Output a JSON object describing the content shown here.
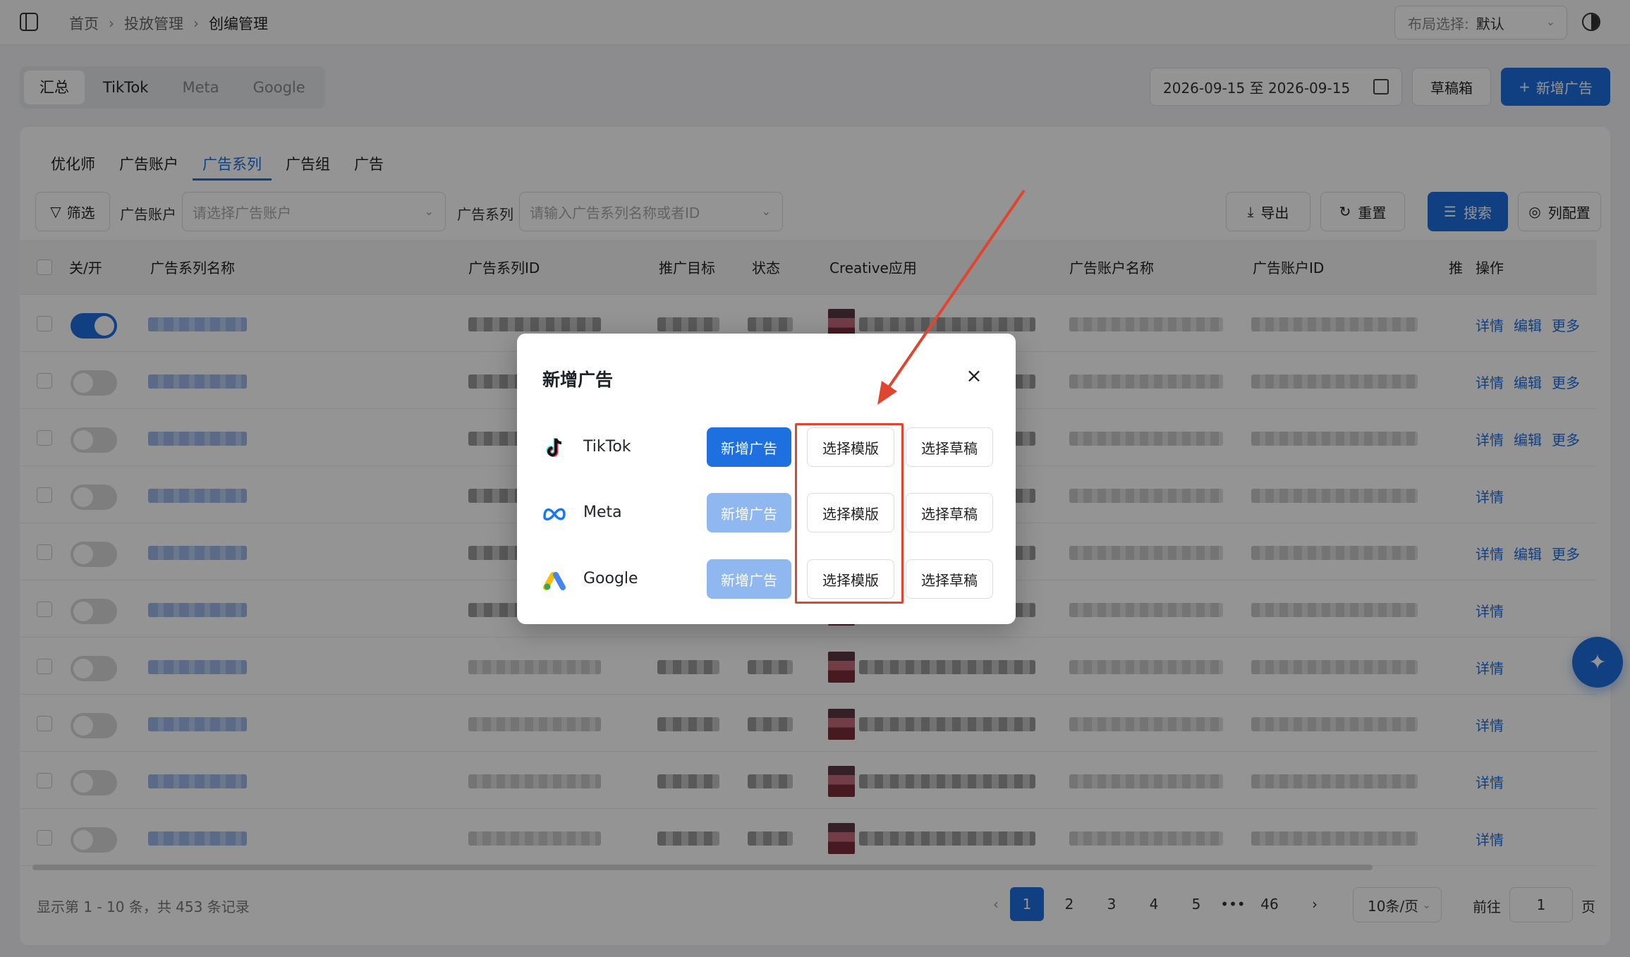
{
  "breadcrumb": {
    "items": [
      "首页",
      "投放管理",
      "创编管理"
    ]
  },
  "layout_select": {
    "label": "布局选择:",
    "value": "默认"
  },
  "platform_tabs": [
    "汇总",
    "TikTok",
    "Meta",
    "Google"
  ],
  "date_range": "2026-09-15 至 2026-09-15",
  "draft_box_label": "草稿箱",
  "new_ad_label": "新增广告",
  "sub_tabs": [
    "优化师",
    "广告账户",
    "广告系列",
    "广告组",
    "广告"
  ],
  "filters": {
    "filter_label": "筛选",
    "account_label": "广告账户",
    "account_placeholder": "请选择广告账户",
    "series_label": "广告系列",
    "series_placeholder": "请输入广告系列名称或者ID"
  },
  "tools": {
    "export": "导出",
    "reset": "重置",
    "search": "搜索",
    "columns": "列配置"
  },
  "table": {
    "headers": [
      "关/开",
      "广告系列名称",
      "广告系列ID",
      "推广目标",
      "状态",
      "Creative应用",
      "广告账户名称",
      "广告账户ID",
      "推",
      "操作"
    ],
    "ops": {
      "detail": "详情",
      "edit": "编辑",
      "more": "更多"
    },
    "rows": [
      {
        "on": true,
        "ops": 3
      },
      {
        "on": false,
        "ops": 3
      },
      {
        "on": false,
        "ops": 3
      },
      {
        "on": false,
        "ops": 1
      },
      {
        "on": false,
        "ops": 3
      },
      {
        "on": false,
        "ops": 1
      },
      {
        "on": false,
        "ops": 1
      },
      {
        "on": false,
        "ops": 1
      },
      {
        "on": false,
        "ops": 1
      },
      {
        "on": false,
        "ops": 1
      }
    ]
  },
  "pagination": {
    "info": "显示第 1 - 10 条，共 453 条记录",
    "pages": [
      "1",
      "2",
      "3",
      "4",
      "5",
      "•••",
      "46"
    ],
    "current": "1",
    "page_size": "10条/页",
    "goto_label": "前往",
    "goto_value": "1",
    "page_unit": "页"
  },
  "modal": {
    "title": "新增广告",
    "rows": [
      {
        "name": "TikTok",
        "icon": "tiktok-icon",
        "add": "新增广告",
        "template": "选择模版",
        "draft": "选择草稿"
      },
      {
        "name": "Meta",
        "icon": "meta-icon",
        "add": "新增广告",
        "template": "选择模版",
        "draft": "选择草稿"
      },
      {
        "name": "Google",
        "icon": "google-ads-icon",
        "add": "新增广告",
        "template": "选择模版",
        "draft": "选择草稿"
      }
    ]
  },
  "colors": {
    "primary": "#1e6fe0",
    "annotation": "#e0452f"
  }
}
